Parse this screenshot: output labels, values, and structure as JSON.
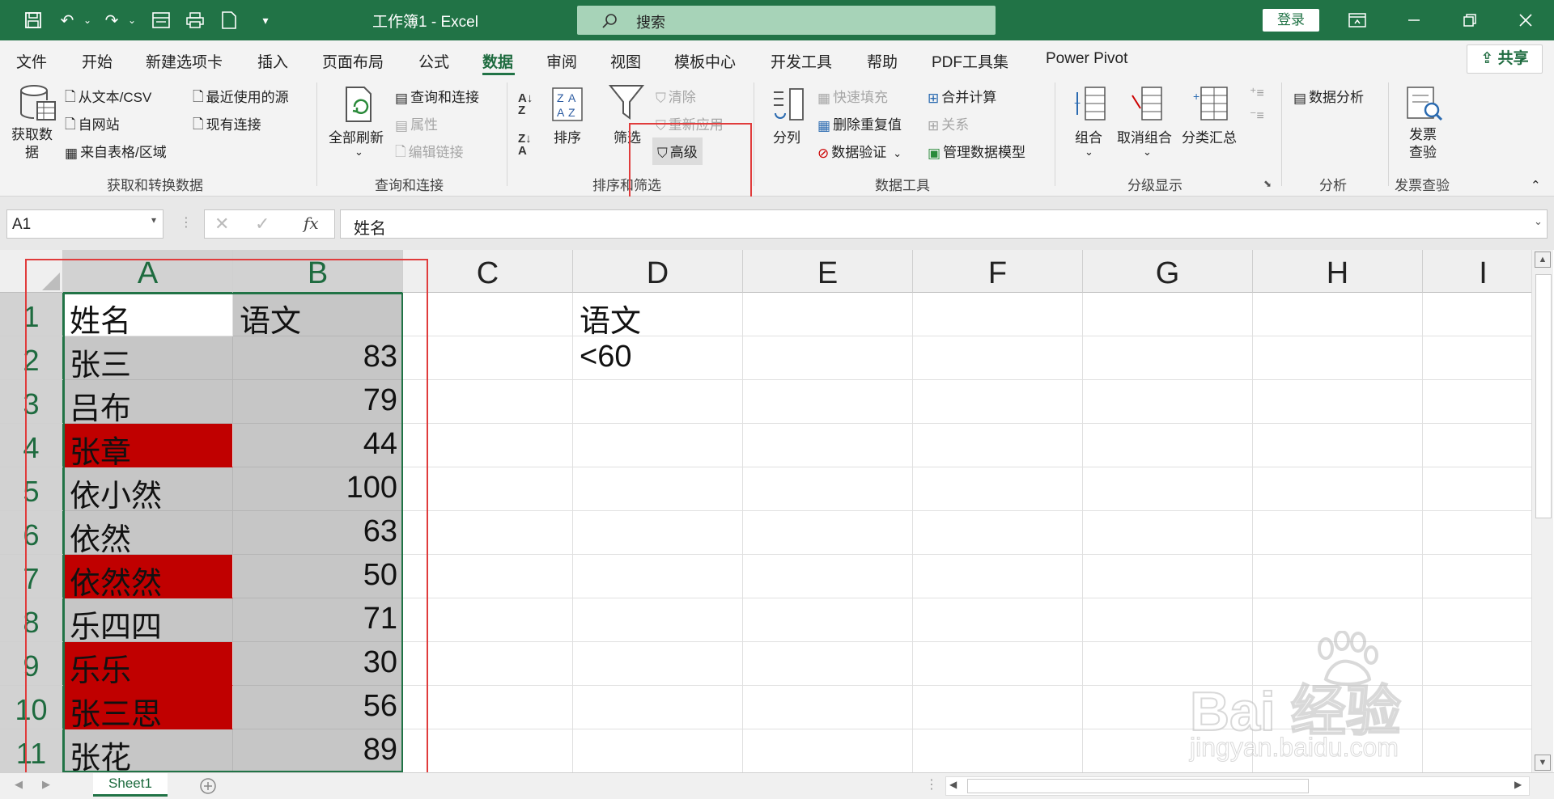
{
  "app": {
    "doc_title": "工作簿1  -  Excel",
    "search_placeholder": "搜索",
    "login": "登录"
  },
  "tabs": [
    "文件",
    "开始",
    "新建选项卡",
    "插入",
    "页面布局",
    "公式",
    "数据",
    "审阅",
    "视图",
    "模板中心",
    "开发工具",
    "帮助",
    "PDF工具集",
    "Power Pivot"
  ],
  "active_tab": "数据",
  "share": "共享",
  "ribbon": {
    "get_data": {
      "big_button": "获取数\n据",
      "from_text": "从文本/CSV",
      "from_web": "自网站",
      "from_table": "来自表格/区域",
      "recent": "最近使用的源",
      "existing": "现有连接",
      "group": "获取和转换数据"
    },
    "queries": {
      "refresh_all": "全部刷新",
      "queries_connections": "查询和连接",
      "properties": "属性",
      "edit_links": "编辑链接",
      "group": "查询和连接"
    },
    "sort_filter": {
      "sort": "排序",
      "filter": "筛选",
      "clear": "清除",
      "reapply": "重新应用",
      "advanced": "高级",
      "group": "排序和筛选"
    },
    "data_tools": {
      "split": "分列",
      "flash_fill": "快速填充",
      "remove_dup": "删除重复值",
      "validation": "数据验证",
      "consolidate": "合并计算",
      "relations": "关系",
      "data_model": "管理数据模型",
      "group": "数据工具"
    },
    "outline": {
      "group_btn": "组合",
      "ungroup": "取消组合",
      "subtotal": "分类汇总",
      "group": "分级显示"
    },
    "analysis": {
      "data_analysis": "数据分析",
      "group": "分析"
    },
    "invoice": {
      "button": "发票\n查验",
      "group": "发票查验"
    }
  },
  "formula_bar": {
    "name_box": "A1",
    "formula": "姓名",
    "fx": "fx"
  },
  "grid": {
    "columns": [
      "A",
      "B",
      "C",
      "D",
      "E",
      "F",
      "G",
      "H",
      "I"
    ],
    "rows": [
      "1",
      "2",
      "3",
      "4",
      "5",
      "6",
      "7",
      "8",
      "9",
      "10",
      "11"
    ],
    "names": [
      "姓名",
      "张三",
      "吕布",
      "张章",
      "依小然",
      "依然",
      "依然然",
      "乐四四",
      "乐乐",
      "张三思",
      "张花"
    ],
    "scores": [
      "语文",
      "83",
      "79",
      "44",
      "100",
      "63",
      "50",
      "71",
      "30",
      "56",
      "89"
    ],
    "highlighted_rows": [
      4,
      7,
      9,
      10
    ],
    "highlight_color": "#c00000",
    "criteria_header": "语文",
    "criteria_value": "<60"
  },
  "sheet_tab": "Sheet1",
  "watermark": {
    "brand": "Bai 经验",
    "url": "jingyan.baidu.com"
  }
}
